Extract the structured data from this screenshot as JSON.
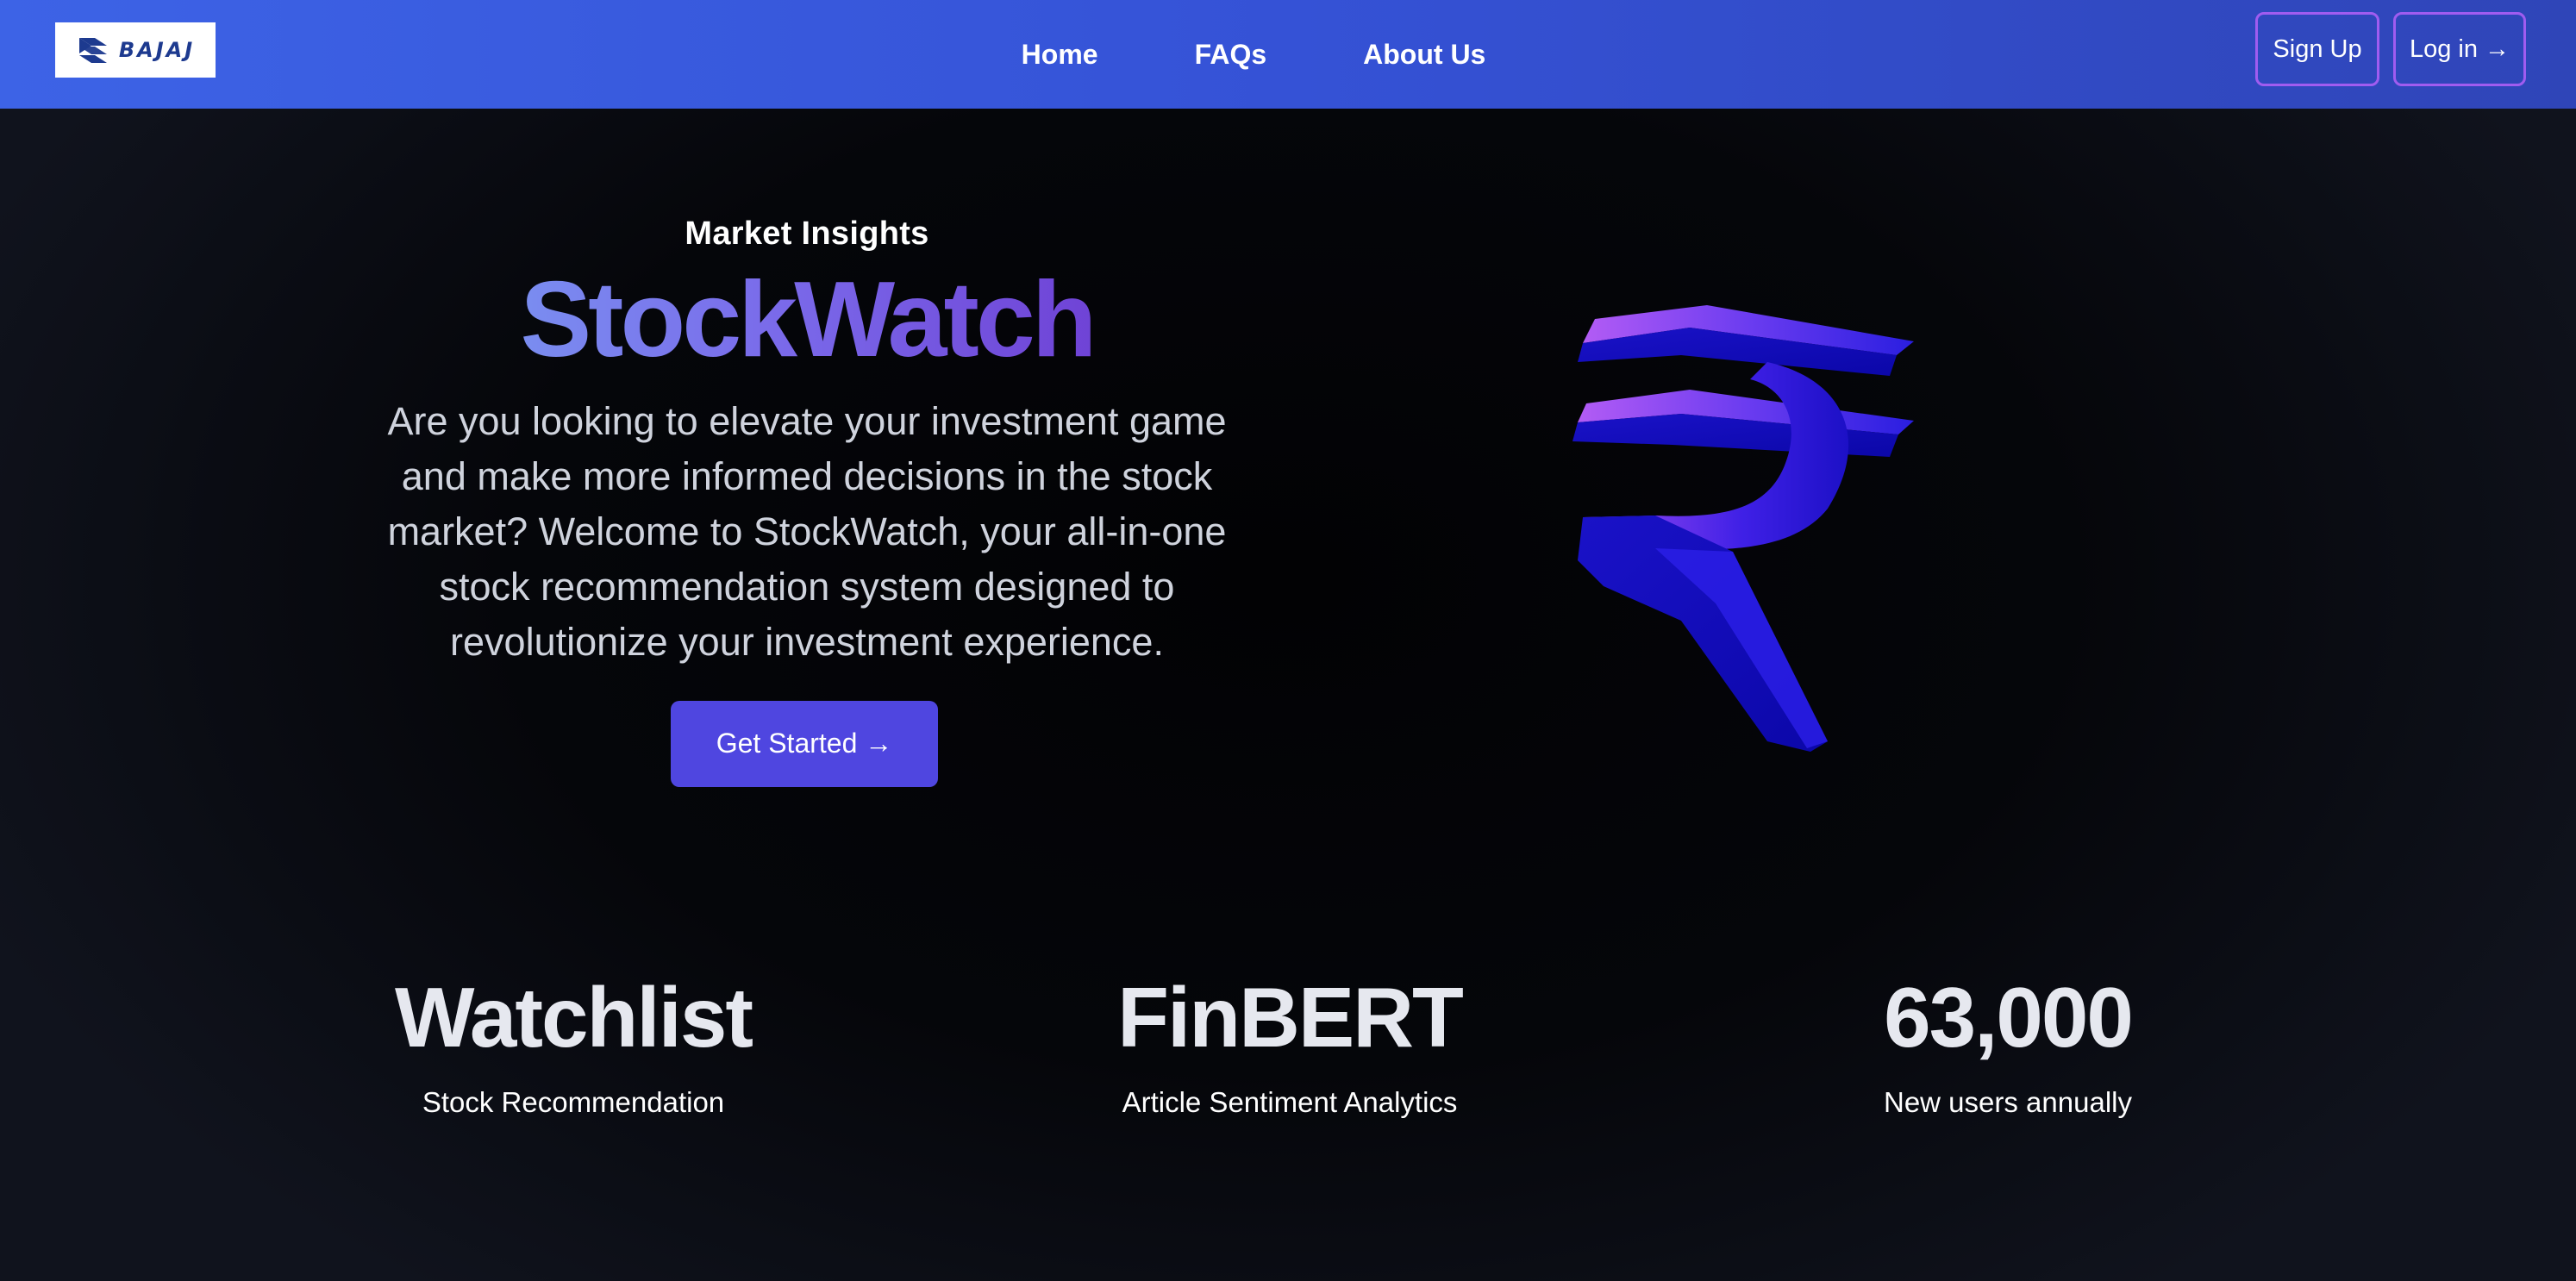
{
  "navbar": {
    "logo_text": "BAJAJ",
    "links": [
      "Home",
      "FAQs",
      "About Us"
    ],
    "signup_label": "Sign Up",
    "login_label": "Log in →",
    "gradient_start": "#3d63e6",
    "gradient_end": "#2f45b8",
    "button_border_color": "#a05cf0"
  },
  "hero": {
    "eyebrow": "Market Insights",
    "title": "StockWatch",
    "description": "Are you looking to elevate your investment game and make more informed decisions in the stock market? Welcome to StockWatch, your all-in-one stock recommendation system designed to revolutionize your investment experience.",
    "cta_label": "Get Started →",
    "cta_color": "#4f46e0",
    "illustration_icon": "rupee-3d-icon"
  },
  "stats": [
    {
      "value": "Watchlist",
      "label": "Stock Recommendation"
    },
    {
      "value": "FinBERT",
      "label": "Article Sentiment Analytics"
    },
    {
      "value": "63,000",
      "label": "New users annually"
    }
  ]
}
